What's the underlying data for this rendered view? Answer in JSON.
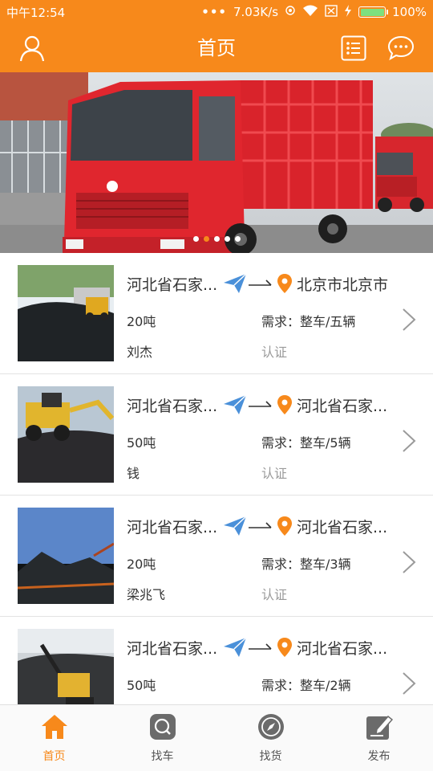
{
  "status_bar": {
    "time": "中午12:54",
    "dots": "•••",
    "speed": "7.03K/s",
    "battery": "100%",
    "battery_level": 1.0
  },
  "header": {
    "title": "首页",
    "left_icon": "user-icon",
    "right_icons": [
      "list-icon",
      "message-icon"
    ]
  },
  "banner": {
    "page_count": 5,
    "active_index": 1
  },
  "shipments": [
    {
      "from": "河北省石家庄市",
      "to": "北京市北京市",
      "weight": "20吨",
      "demand": "需求：整车/五辆",
      "contact": "刘杰",
      "status": "认证"
    },
    {
      "from": "河北省石家庄市",
      "to": "河北省石家庄市",
      "weight": "50吨",
      "demand": "需求：整车/5辆",
      "contact": "钱",
      "status": "认证"
    },
    {
      "from": "河北省石家庄市",
      "to": "河北省石家庄市",
      "weight": "20吨",
      "demand": "需求：整车/3辆",
      "contact": "梁兆飞",
      "status": "认证"
    },
    {
      "from": "河北省石家庄市",
      "to": "河北省石家庄市",
      "weight": "50吨",
      "demand": "需求：整车/2辆",
      "contact": "",
      "status": ""
    }
  ],
  "tabs": [
    {
      "label": "首页",
      "icon": "home-icon",
      "active": true
    },
    {
      "label": "找车",
      "icon": "search-icon",
      "active": false
    },
    {
      "label": "找货",
      "icon": "compass-icon",
      "active": false
    },
    {
      "label": "发布",
      "icon": "edit-icon",
      "active": false
    }
  ],
  "colors": {
    "brand": "#f7891b",
    "route_icon": "#4a90d9",
    "pin": "#f7891b"
  }
}
